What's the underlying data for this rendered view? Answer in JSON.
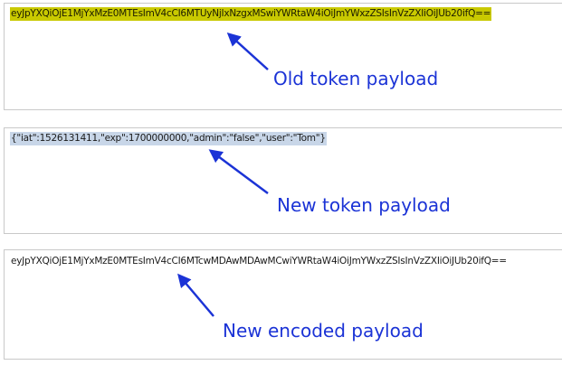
{
  "old_token": {
    "payload": "eyJpYXQiOjE1MjYxMzE0MTEsImV4cCI6MTUyNjIxNzgxMSwiYWRtaW4iOiJmYWxzZSIsInVzZXIiOiJUb20ifQ==",
    "annotation": "Old token payload"
  },
  "new_token": {
    "payload": "{\"iat\":1526131411,\"exp\":1700000000,\"admin\":\"false\",\"user\":\"Tom\"}",
    "annotation": "New token payload"
  },
  "new_encoded": {
    "payload": "eyJpYXQiOjE1MjYxMzE0MTEsImV4cCI6MTcwMDAwMDAwMCwiYWRtaW4iOiJmYWxzZSIsInVzZXIiOiJUb20ifQ==",
    "annotation": "New encoded payload"
  },
  "colors": {
    "annotation": "#1b33d6",
    "highlight_old": "#c9c900",
    "highlight_new": "#c8d6e8",
    "panel_border": "#c9c9c9"
  }
}
